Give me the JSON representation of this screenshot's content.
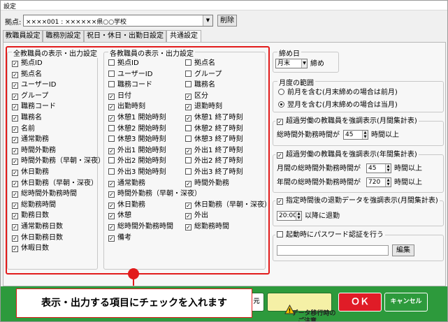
{
  "window": {
    "title": "設定"
  },
  "location": {
    "label": "拠点:",
    "value": "××××001 : ××××××県○○学校",
    "delete_label": "削除"
  },
  "tabs": [
    {
      "label": "教職員設定",
      "active": false
    },
    {
      "label": "職務別設定",
      "active": false
    },
    {
      "label": "祝日・休日・出勤日設定",
      "active": false
    },
    {
      "label": "共通設定",
      "active": true
    }
  ],
  "all_staff": {
    "title": "全教職員の表示・出力設定",
    "items": [
      {
        "label": "拠点ID",
        "checked": true
      },
      {
        "label": "拠点名",
        "checked": true
      },
      {
        "label": "ユーザーID",
        "checked": true
      },
      {
        "label": "グループ",
        "checked": true
      },
      {
        "label": "職務コード",
        "checked": true
      },
      {
        "label": "職務名",
        "checked": true
      },
      {
        "label": "名前",
        "checked": true
      },
      {
        "label": "通常勤務",
        "checked": true
      },
      {
        "label": "時間外勤務",
        "checked": true
      },
      {
        "label": "時間外勤務（早朝・深夜）",
        "checked": true
      },
      {
        "label": "休日勤務",
        "checked": true
      },
      {
        "label": "休日勤務（早朝・深夜）",
        "checked": true
      },
      {
        "label": "総時間外勤務時間",
        "checked": true
      },
      {
        "label": "総勤務時間",
        "checked": true
      },
      {
        "label": "勤務日数",
        "checked": true
      },
      {
        "label": "通常勤務日数",
        "checked": true
      },
      {
        "label": "休日勤務日数",
        "checked": true
      },
      {
        "label": "休暇日数",
        "checked": true
      }
    ]
  },
  "each_staff": {
    "title": "各教職員の表示・出力設定",
    "left": [
      {
        "label": "拠点ID",
        "checked": false
      },
      {
        "label": "ユーザーID",
        "checked": false
      },
      {
        "label": "職務コード",
        "checked": false
      },
      {
        "label": "日付",
        "checked": true
      },
      {
        "label": "出勤時刻",
        "checked": true
      },
      {
        "label": "休憩1 開始時刻",
        "checked": true
      },
      {
        "label": "休憩2 開始時刻",
        "checked": false
      },
      {
        "label": "休憩3 開始時刻",
        "checked": false
      },
      {
        "label": "外出1 開始時刻",
        "checked": true
      },
      {
        "label": "外出2 開始時刻",
        "checked": false
      },
      {
        "label": "外出3 開始時刻",
        "checked": false
      },
      {
        "label": "通常勤務",
        "checked": true
      },
      {
        "label": "時間外勤務（早朝・深夜）",
        "checked": true
      },
      {
        "label": "休日勤務",
        "checked": true
      },
      {
        "label": "休憩",
        "checked": true
      },
      {
        "label": "総時間外勤務時間",
        "checked": true
      },
      {
        "label": "備考",
        "checked": true
      }
    ],
    "right": [
      {
        "label": "拠点名",
        "checked": false
      },
      {
        "label": "グループ",
        "checked": false
      },
      {
        "label": "職務名",
        "checked": false
      },
      {
        "label": "区分",
        "checked": true
      },
      {
        "label": "退勤時刻",
        "checked": true
      },
      {
        "label": "休憩1 終了時刻",
        "checked": true
      },
      {
        "label": "休憩2 終了時刻",
        "checked": false
      },
      {
        "label": "休憩3 終了時刻",
        "checked": false
      },
      {
        "label": "外出1 終了時刻",
        "checked": true
      },
      {
        "label": "外出2 終了時刻",
        "checked": false
      },
      {
        "label": "外出3 終了時刻",
        "checked": false
      },
      {
        "label": "時間外勤務",
        "checked": true
      },
      {
        "label": "",
        "checked": false
      },
      {
        "label": "休日勤務（早朝・深夜）",
        "checked": true
      },
      {
        "label": "外出",
        "checked": true
      },
      {
        "label": "総勤務時間",
        "checked": true
      },
      {
        "label": "",
        "checked": false
      }
    ]
  },
  "closing": {
    "title": "締め日",
    "value": "月末",
    "suffix": "締め"
  },
  "month_range": {
    "title": "月度の範囲",
    "options": [
      {
        "label": "前月を含む(月末締めの場合は前月)",
        "selected": false
      },
      {
        "label": "翌月を含む(月末締めの場合は当月)",
        "selected": true
      }
    ]
  },
  "overwork_month": {
    "title": "超過労働の教職員を強調表示(月間集計表)",
    "checked": true,
    "row_label": "総時間外勤務時間が",
    "value": "45",
    "suffix": "時間以上"
  },
  "overwork_year": {
    "title": "超過労働の教職員を強調表示(年間集計表)",
    "checked": true,
    "rows": [
      {
        "label": "月間の総時間外勤務時間が",
        "value": "45",
        "suffix": "時間以上"
      },
      {
        "label": "年間の総時間外勤務時間が",
        "value": "720",
        "suffix": "時間以上"
      }
    ]
  },
  "late_leave": {
    "title": "指定時間後の退勤データを強調表示(月間集計表)",
    "checked": true,
    "value": "20:00",
    "suffix": "以降に退勤"
  },
  "startup_password": {
    "title": "起動時にパスワード認証を行う",
    "checked": false,
    "edit_label": "編集"
  },
  "footer": {
    "partial_label": "元",
    "migrate_label": "データ移行時の\nご注意",
    "ok_label": "ＯＫ",
    "cancel_label": "キャンセル",
    "warning_icon_text": "!"
  },
  "callout": {
    "text": "表示・出力する項目にチェックを入れます"
  }
}
